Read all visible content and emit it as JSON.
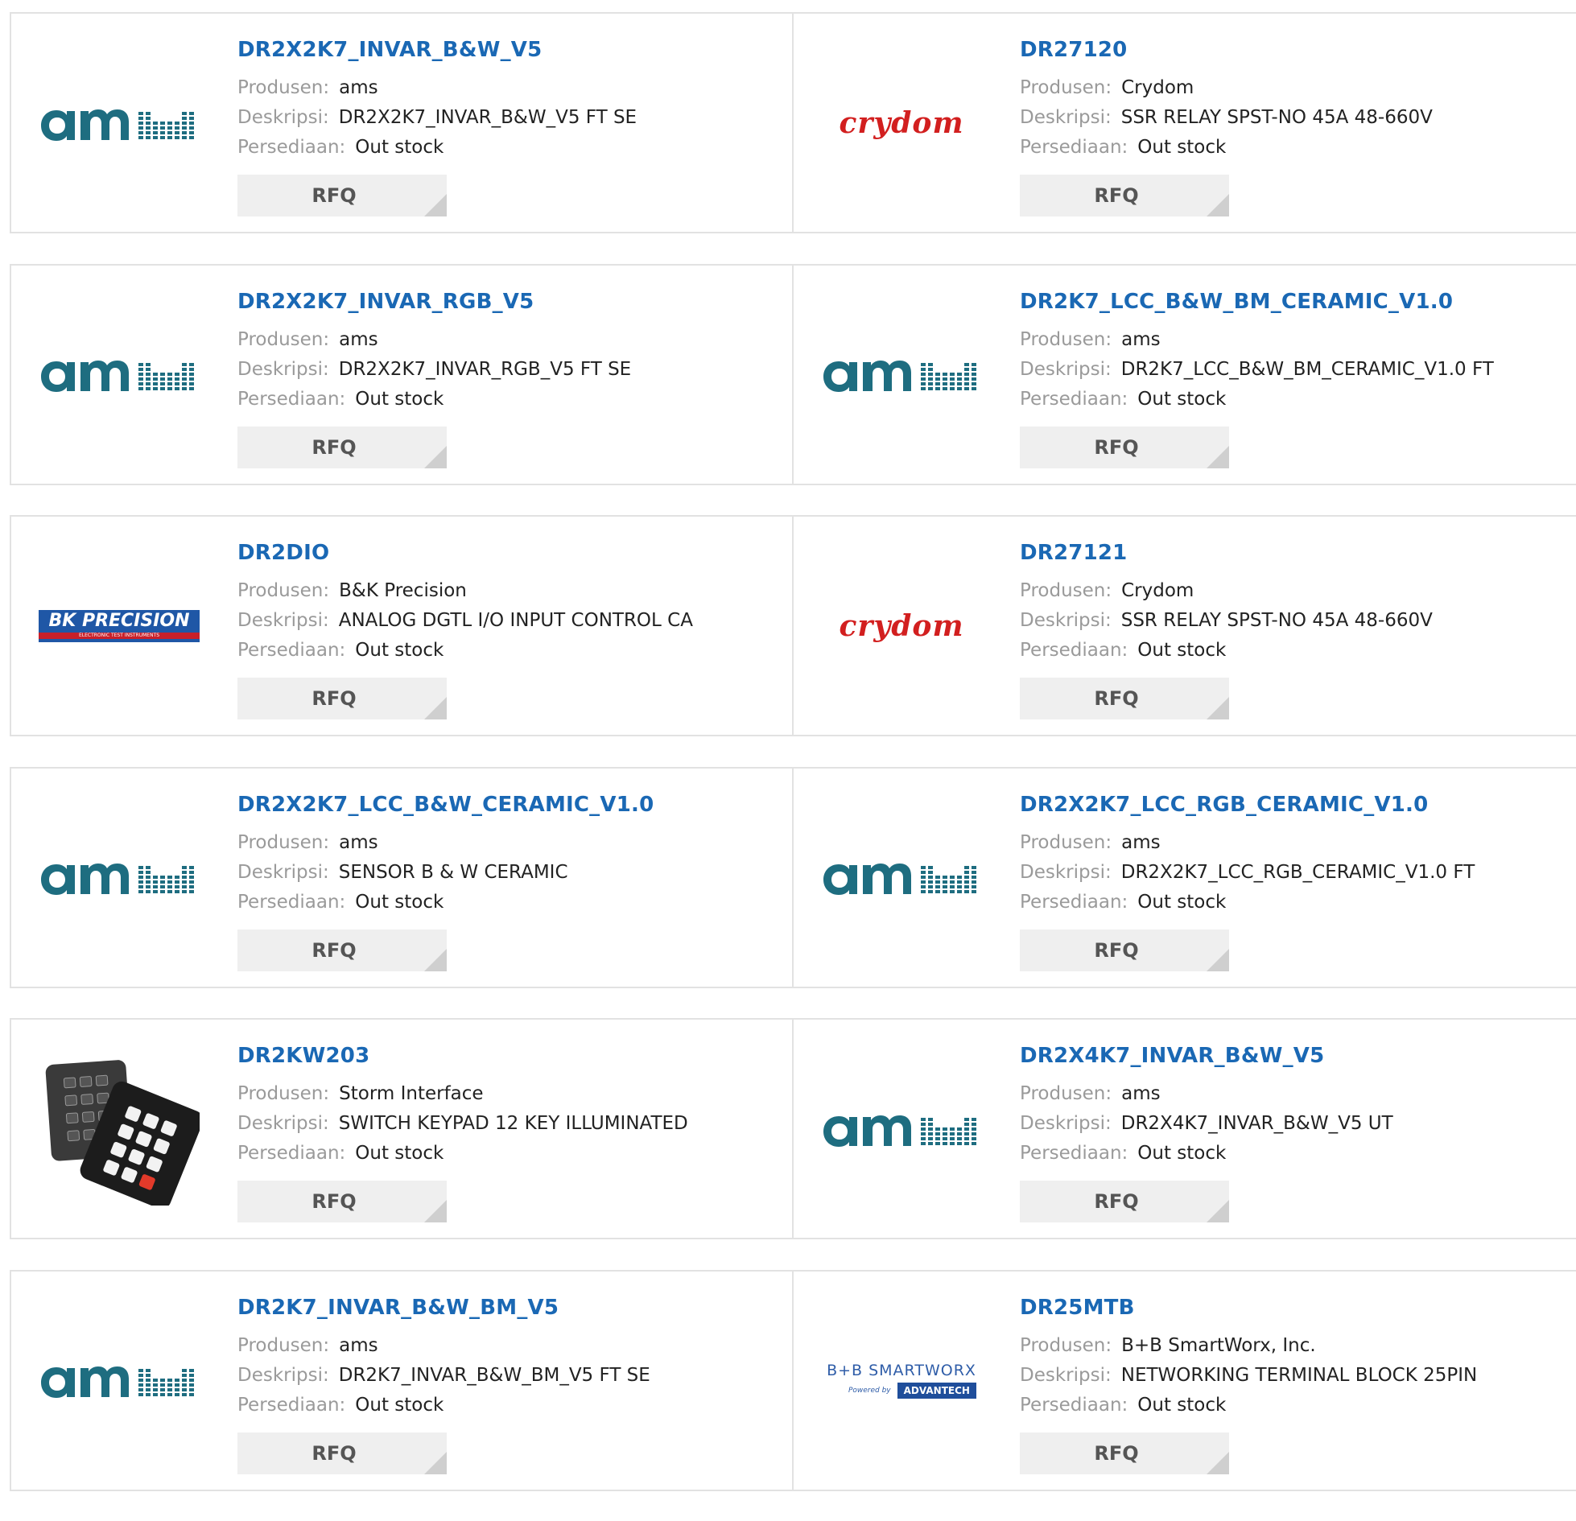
{
  "labels": {
    "produsen": "Produsen:",
    "deskripsi": "Deskripsi:",
    "persediaan": "Persediaan:",
    "rfq": "RFQ"
  },
  "colors": {
    "link": "#1a68b4",
    "ams_brand": "#1e6d80",
    "crydom_brand": "#d21f1f",
    "bk_brand": "#1f57a6",
    "button_bg": "#efefef"
  },
  "products": [
    {
      "part": "DR2X2K7_INVAR_B&W_V5",
      "manufacturer": "ams",
      "description": "DR2X2K7_INVAR_B&W_V5 FT SE",
      "stock": "Out stock",
      "logo": "ams-logo"
    },
    {
      "part": "DR27120",
      "manufacturer": "Crydom",
      "description": "SSR RELAY SPST-NO 45A 48-660V",
      "stock": "Out stock",
      "logo": "crydom-logo",
      "logo_text": "crydom"
    },
    {
      "part": "DR2X2K7_INVAR_RGB_V5",
      "manufacturer": "ams",
      "description": "DR2X2K7_INVAR_RGB_V5 FT SE",
      "stock": "Out stock",
      "logo": "ams-logo"
    },
    {
      "part": "DR2K7_LCC_B&W_BM_CERAMIC_V1.0",
      "manufacturer": "ams",
      "description": "DR2K7_LCC_B&W_BM_CERAMIC_V1.0 FT",
      "stock": "Out stock",
      "logo": "ams-logo"
    },
    {
      "part": "DR2DIO",
      "manufacturer": "B&K Precision",
      "description": "ANALOG DGTL I/O INPUT CONTROL CA",
      "stock": "Out stock",
      "logo": "bk-precision-logo",
      "logo_text": "BK PRECISION",
      "logo_subtext": "ELECTRONIC TEST INSTRUMENTS"
    },
    {
      "part": "DR27121",
      "manufacturer": "Crydom",
      "description": "SSR RELAY SPST-NO 45A 48-660V",
      "stock": "Out stock",
      "logo": "crydom-logo",
      "logo_text": "crydom"
    },
    {
      "part": "DR2X2K7_LCC_B&W_CERAMIC_V1.0",
      "manufacturer": "ams",
      "description": "SENSOR B & W CERAMIC",
      "stock": "Out stock",
      "logo": "ams-logo"
    },
    {
      "part": "DR2X2K7_LCC_RGB_CERAMIC_V1.0",
      "manufacturer": "ams",
      "description": "DR2X2K7_LCC_RGB_CERAMIC_V1.0 FT",
      "stock": "Out stock",
      "logo": "ams-logo"
    },
    {
      "part": "DR2KW203",
      "manufacturer": "Storm Interface",
      "description": "SWITCH KEYPAD 12 KEY ILLUMINATED",
      "stock": "Out stock",
      "logo": "keypad-image"
    },
    {
      "part": "DR2X4K7_INVAR_B&W_V5",
      "manufacturer": "ams",
      "description": "DR2X4K7_INVAR_B&W_V5 UT",
      "stock": "Out stock",
      "logo": "ams-logo"
    },
    {
      "part": "DR2K7_INVAR_B&W_BM_V5",
      "manufacturer": "ams",
      "description": "DR2K7_INVAR_B&W_BM_V5 FT SE",
      "stock": "Out stock",
      "logo": "ams-logo"
    },
    {
      "part": "DR25MTB",
      "manufacturer": "B+B SmartWorx, Inc.",
      "description": "NETWORKING TERMINAL BLOCK 25PIN",
      "stock": "Out stock",
      "logo": "bb-smartworx-logo",
      "logo_text": "B+B SMARTWORX",
      "logo_subtext": "Powered by",
      "logo_subtext2": "ADVANTECH"
    }
  ]
}
